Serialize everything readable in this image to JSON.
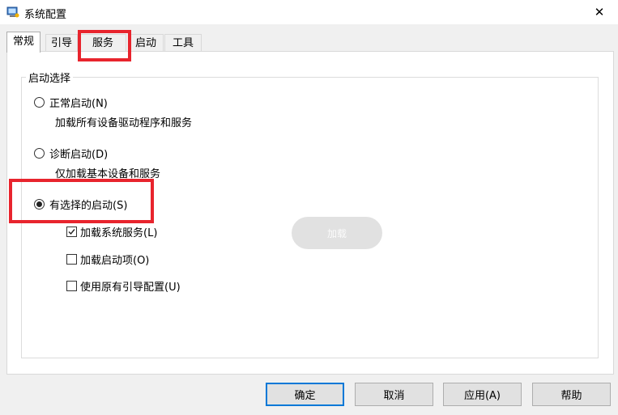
{
  "window": {
    "title": "系统配置",
    "close_glyph": "✕"
  },
  "tabs": [
    {
      "label": "常规"
    },
    {
      "label": "引导"
    },
    {
      "label": "服务"
    },
    {
      "label": "启动"
    },
    {
      "label": "工具"
    }
  ],
  "active_tab": "常规",
  "group": {
    "legend": "启动选择",
    "options": [
      {
        "label": "正常启动(N)",
        "description": "加载所有设备驱动程序和服务",
        "selected": false
      },
      {
        "label": "诊断启动(D)",
        "description": "仅加载基本设备和服务",
        "selected": false
      },
      {
        "label": "有选择的启动(S)",
        "selected": true
      }
    ],
    "checkboxes": [
      {
        "label": "加载系统服务(L)",
        "checked": true
      },
      {
        "label": "加载启动项(O)",
        "checked": false
      },
      {
        "label": "使用原有引导配置(U)",
        "checked": false
      }
    ]
  },
  "overlay": {
    "text": "加载"
  },
  "buttons": {
    "ok": "确定",
    "cancel": "取消",
    "apply": "应用(A)",
    "help": "帮助"
  },
  "colors": {
    "highlight": "#e8242d",
    "default_button_border": "#0078d7"
  }
}
